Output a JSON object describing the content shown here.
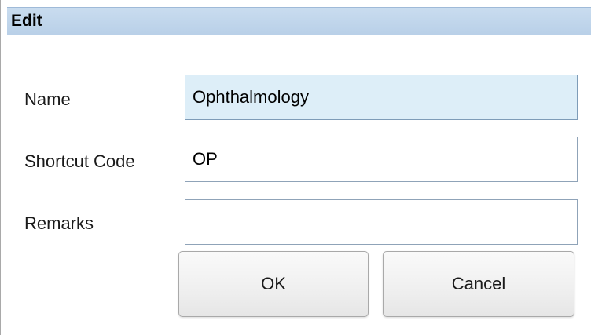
{
  "dialog": {
    "title": "Edit"
  },
  "form": {
    "name": {
      "label": "Name",
      "value": "Ophthalmology"
    },
    "shortcut_code": {
      "label": "Shortcut Code",
      "value": "OP"
    },
    "remarks": {
      "label": "Remarks",
      "value": ""
    }
  },
  "buttons": {
    "ok_label": "OK",
    "cancel_label": "Cancel"
  },
  "colors": {
    "titlebar": "#c9dcef",
    "focused_field": "#ddeef8",
    "field_border": "#8fa3b8"
  }
}
